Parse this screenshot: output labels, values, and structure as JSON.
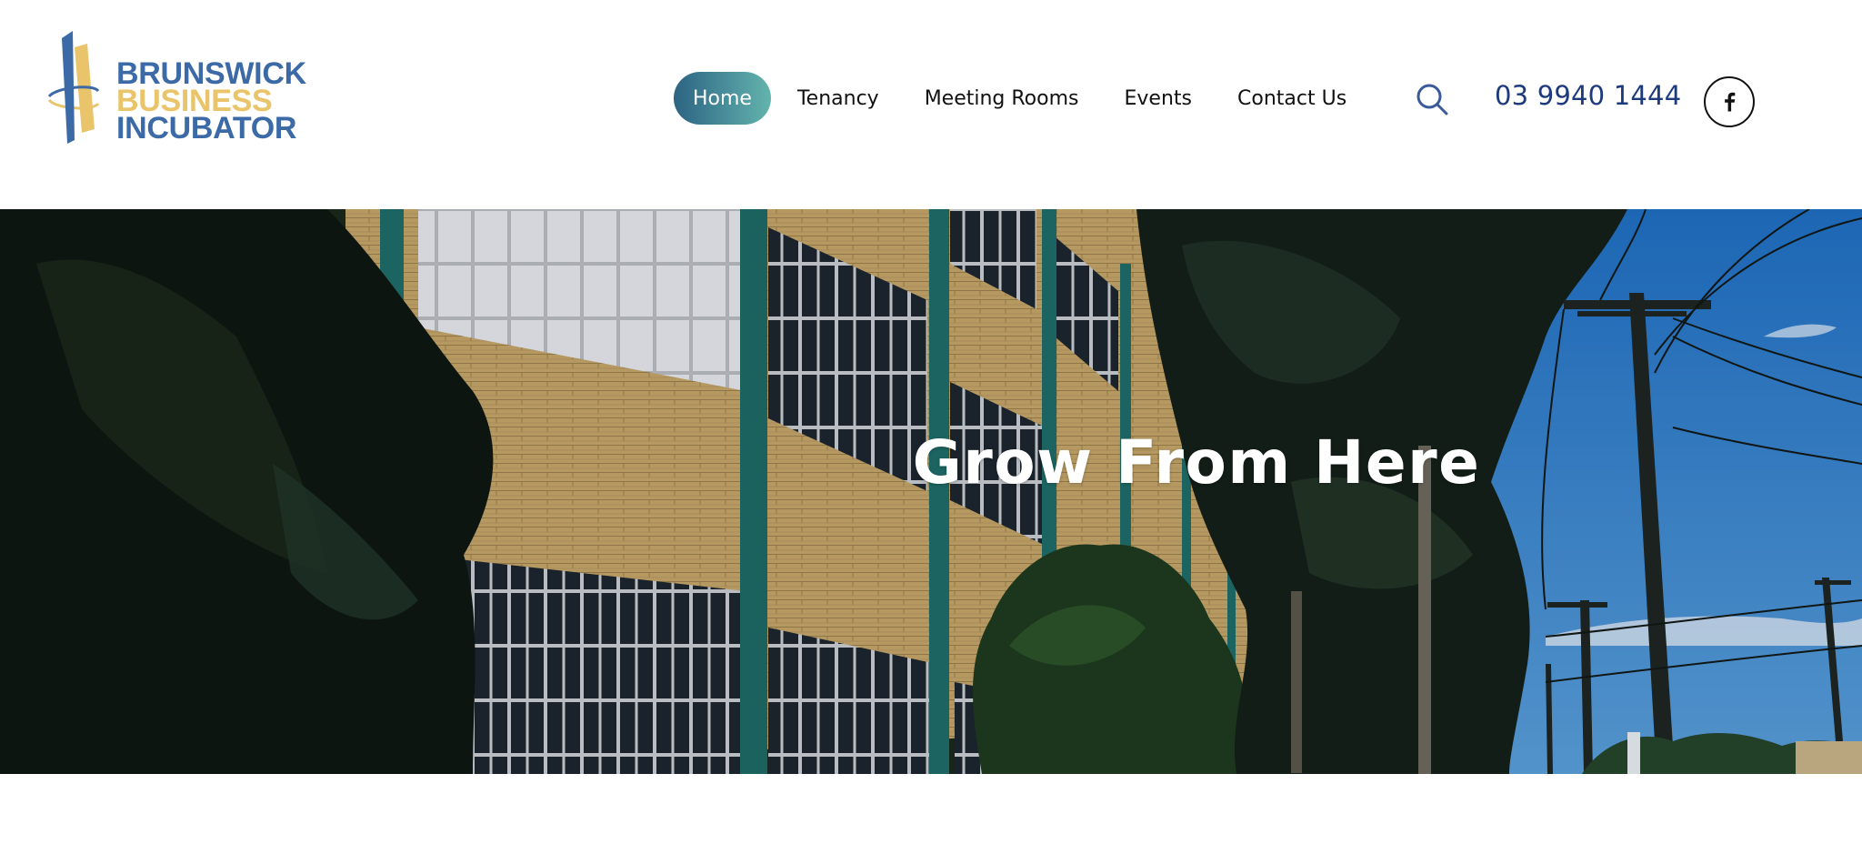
{
  "logo": {
    "line1": "BRUNSWICK",
    "line2": "BUSINESS",
    "line3": "INCUBATOR",
    "colors": {
      "blue": "#3b6aa6",
      "gold": "#e9c46a"
    }
  },
  "nav": {
    "items": [
      {
        "label": "Home",
        "active": true
      },
      {
        "label": "Tenancy",
        "active": false
      },
      {
        "label": "Meeting Rooms",
        "active": false
      },
      {
        "label": "Events",
        "active": false
      },
      {
        "label": "Contact Us",
        "active": false
      }
    ],
    "active_gradient": [
      "#2c6482",
      "#63b4ad"
    ]
  },
  "header_actions": {
    "search_icon": "search-icon",
    "phone": "03 9940 1444",
    "phone_color": "#1d3a7c",
    "social_icon": "facebook-icon"
  },
  "hero": {
    "title": "Grow From Here",
    "image_description": "Brick building with teal columns, trees and power poles under blue sky"
  }
}
